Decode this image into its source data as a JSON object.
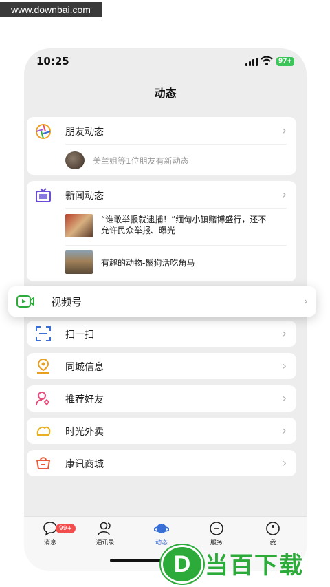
{
  "watermark_top": "www.downbai.com",
  "status": {
    "time": "10:25",
    "battery": "97+"
  },
  "page_title": "动态",
  "moments": {
    "label": "朋友动态",
    "friend_update": "美兰姐等1位朋友有新动态"
  },
  "news": {
    "label": "新闻动态",
    "items": [
      {
        "line1": "“谁敢举报就逮捕！”缅甸小镇赌博盛行，还不",
        "line2": "允许民众举报、曝光"
      },
      {
        "line1": "有趣的动物-鬣狗活吃角马"
      }
    ]
  },
  "popup": {
    "label": "视频号"
  },
  "menu": [
    {
      "label": "扫一扫",
      "icon": "scan-icon"
    },
    {
      "label": "同城信息",
      "icon": "location-icon"
    },
    {
      "label": "推荐好友",
      "icon": "recommend-friend-icon"
    },
    {
      "label": "时光外卖",
      "icon": "takeout-icon"
    },
    {
      "label": "康讯商城",
      "icon": "mall-icon"
    }
  ],
  "tabs": [
    {
      "label": "消息",
      "badge": "99+"
    },
    {
      "label": "通讯录"
    },
    {
      "label": "动态"
    },
    {
      "label": "服务"
    },
    {
      "label": "我"
    }
  ],
  "watermark_bottom": {
    "letter": "D",
    "text": "当百下载"
  },
  "colors": {
    "accent_blue": "#3a6fd8",
    "badge_red": "#f24e4e",
    "brand_green": "#2cab3a"
  }
}
